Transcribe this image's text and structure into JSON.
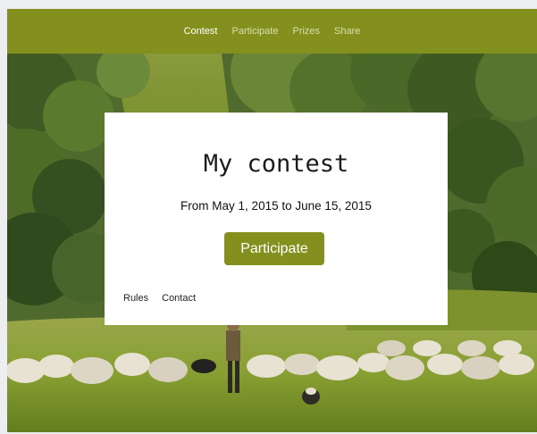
{
  "nav": {
    "items": [
      {
        "label": "Contest",
        "active": true
      },
      {
        "label": "Participate",
        "active": false
      },
      {
        "label": "Prizes",
        "active": false
      },
      {
        "label": "Share",
        "active": false
      }
    ]
  },
  "card": {
    "title": "My contest",
    "dates": "From May 1, 2015 to June 15, 2015",
    "cta_label": "Participate",
    "links": [
      "Rules",
      "Contact"
    ]
  },
  "hero": {
    "image": "landscape-photo-forest-meadow-sheep-flock-shepherd"
  },
  "colors": {
    "accent": "#83901e",
    "nav_active_text": "#ffffff",
    "nav_text": "#d8dfb0",
    "card_background": "#ffffff"
  }
}
